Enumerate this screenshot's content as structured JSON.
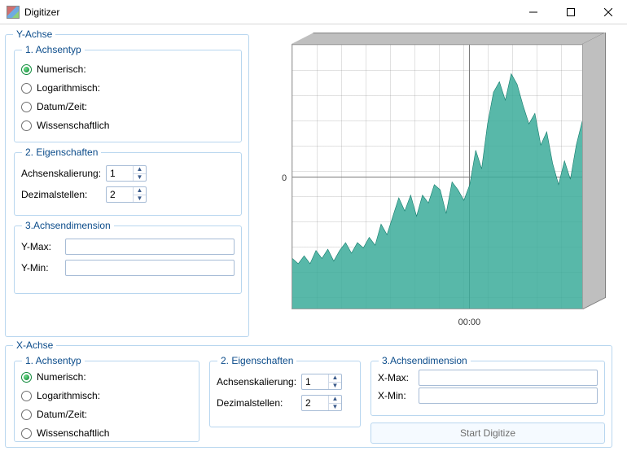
{
  "window": {
    "title": "Digitizer"
  },
  "y_axis": {
    "group": "Y-Achse",
    "type": {
      "group": "1. Achsentyp",
      "options": {
        "numeric": "Numerisch:",
        "log": "Logarithmisch:",
        "datetime": "Datum/Zeit:",
        "scientific": "Wissenschaftlich"
      },
      "selected": "numeric"
    },
    "props": {
      "group": "2. Eigenschaften",
      "scaling_label": "Achsenskalierung:",
      "scaling_value": "1",
      "decimals_label": "Dezimalstellen:",
      "decimals_value": "2"
    },
    "dim": {
      "group": "3.Achsendimension",
      "ymax_label": "Y-Max:",
      "ymax_value": "",
      "ymin_label": "Y-Min:",
      "ymin_value": ""
    }
  },
  "x_axis": {
    "group": "X-Achse",
    "type": {
      "group": "1. Achsentyp",
      "options": {
        "numeric": "Numerisch:",
        "log": "Logarithmisch:",
        "datetime": "Datum/Zeit:",
        "scientific": "Wissenschaftlich"
      },
      "selected": "numeric"
    },
    "props": {
      "group": "2. Eigenschaften",
      "scaling_label": "Achsenskalierung:",
      "scaling_value": "1",
      "decimals_label": "Dezimalstellen:",
      "decimals_value": "2"
    },
    "dim": {
      "group": "3.Achsendimension",
      "xmax_label": "X-Max:",
      "xmax_value": "",
      "xmin_label": "X-Min:",
      "xmin_value": ""
    }
  },
  "chart_labels": {
    "y_center_tick": "0",
    "x_center_tick": "00:00"
  },
  "start_button": "Start Digitize",
  "chart_data": {
    "type": "area",
    "xlabel": "",
    "ylabel": "",
    "y_center": 0,
    "ylim_normalized": [
      -1,
      1
    ],
    "x": [
      0,
      1,
      2,
      3,
      4,
      5,
      6,
      7,
      8,
      9,
      10,
      11,
      12,
      13,
      14,
      15,
      16,
      17,
      18,
      19,
      20,
      21,
      22,
      23,
      24,
      25,
      26,
      27,
      28,
      29,
      30,
      31,
      32,
      33,
      34,
      35,
      36,
      37,
      38,
      39,
      40,
      41,
      42,
      43,
      44,
      45,
      46,
      47,
      48,
      49
    ],
    "y_normalized": [
      -0.62,
      -0.66,
      -0.6,
      -0.66,
      -0.56,
      -0.62,
      -0.55,
      -0.64,
      -0.56,
      -0.5,
      -0.58,
      -0.5,
      -0.54,
      -0.46,
      -0.52,
      -0.36,
      -0.44,
      -0.3,
      -0.16,
      -0.26,
      -0.14,
      -0.3,
      -0.14,
      -0.2,
      -0.06,
      -0.1,
      -0.28,
      -0.04,
      -0.1,
      -0.18,
      -0.06,
      0.2,
      0.06,
      0.4,
      0.64,
      0.72,
      0.58,
      0.78,
      0.7,
      0.54,
      0.4,
      0.48,
      0.24,
      0.34,
      0.1,
      -0.06,
      0.12,
      -0.02,
      0.24,
      0.42
    ],
    "fill_color": "#3bab9a",
    "stroke_color": "#117a6a"
  }
}
